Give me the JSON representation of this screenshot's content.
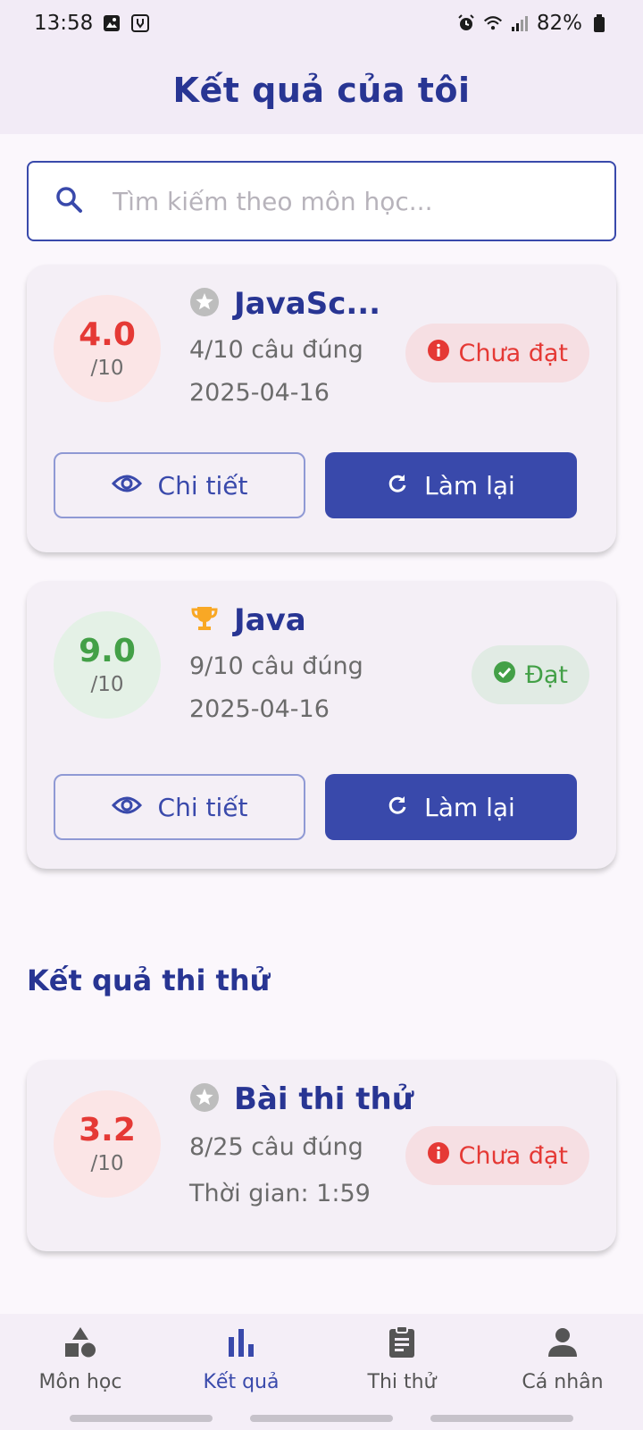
{
  "status_bar": {
    "time": "13:58",
    "battery": "82%"
  },
  "header": {
    "title": "Kết quả của tôi"
  },
  "search": {
    "placeholder": "Tìm kiếm theo môn học..."
  },
  "results": [
    {
      "title": "JavaSc...",
      "score": "4.0",
      "max": "/10",
      "correct": "4/10 câu đúng",
      "date": "2025-04-16",
      "status": "Chưa đạt",
      "status_type": "fail",
      "icon": "star-icon",
      "details_label": "Chi tiết",
      "retry_label": "Làm lại"
    },
    {
      "title": "Java",
      "score": "9.0",
      "max": "/10",
      "correct": "9/10 câu đúng",
      "date": "2025-04-16",
      "status": "Đạt",
      "status_type": "pass",
      "icon": "trophy-icon",
      "details_label": "Chi tiết",
      "retry_label": "Làm lại"
    }
  ],
  "mock_section": {
    "title": "Kết quả thi thử",
    "items": [
      {
        "title": "Bài thi thử",
        "score": "3.2",
        "max": "/10",
        "correct": "8/25 câu đúng",
        "time": "Thời gian: 1:59",
        "status": "Chưa đạt",
        "status_type": "fail",
        "icon": "star-icon"
      }
    ]
  },
  "nav": [
    {
      "label": "Môn học",
      "icon": "shapes-icon",
      "active": false
    },
    {
      "label": "Kết quả",
      "icon": "bar-chart-icon",
      "active": true
    },
    {
      "label": "Thi thử",
      "icon": "clipboard-icon",
      "active": false
    },
    {
      "label": "Cá nhân",
      "icon": "person-icon",
      "active": false
    }
  ],
  "colors": {
    "primary": "#3949ab",
    "title": "#283593",
    "fail": "#e53935",
    "pass": "#43a047",
    "trophy": "#f9a825"
  }
}
